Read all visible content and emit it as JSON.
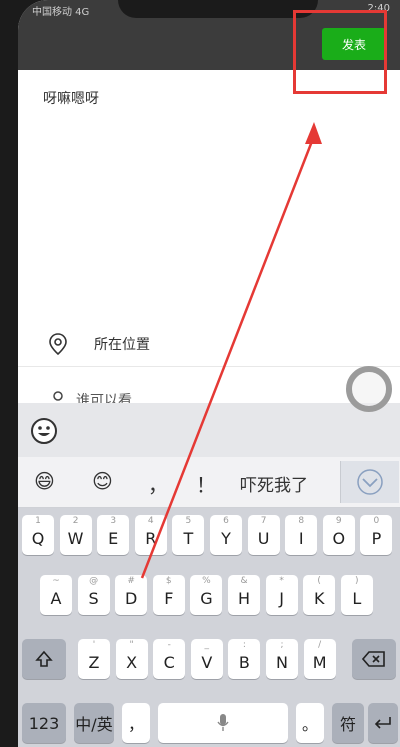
{
  "status": {
    "left": "中国移动 4G",
    "time": "2:40"
  },
  "header": {
    "publish_label": "发表"
  },
  "post": {
    "text": "呀嘛嗯呀"
  },
  "options": {
    "location_label": "所在位置",
    "who_label": "谁可以看"
  },
  "keyboard": {
    "candidates": [
      "😄",
      "😊",
      "，",
      "！",
      "吓死我了"
    ],
    "row1": [
      {
        "k": "Q",
        "h": "1"
      },
      {
        "k": "W",
        "h": "2"
      },
      {
        "k": "E",
        "h": "3"
      },
      {
        "k": "R",
        "h": "4"
      },
      {
        "k": "T",
        "h": "5"
      },
      {
        "k": "Y",
        "h": "6"
      },
      {
        "k": "U",
        "h": "7"
      },
      {
        "k": "I",
        "h": "8"
      },
      {
        "k": "O",
        "h": "9"
      },
      {
        "k": "P",
        "h": "0"
      }
    ],
    "row2": [
      {
        "k": "A",
        "h": "~"
      },
      {
        "k": "S",
        "h": "@"
      },
      {
        "k": "D",
        "h": "#"
      },
      {
        "k": "F",
        "h": "$"
      },
      {
        "k": "G",
        "h": "%"
      },
      {
        "k": "H",
        "h": "&"
      },
      {
        "k": "J",
        "h": "*"
      },
      {
        "k": "K",
        "h": "("
      },
      {
        "k": "L",
        "h": ")"
      }
    ],
    "row3": [
      {
        "k": "Z",
        "h": "'"
      },
      {
        "k": "X",
        "h": "\""
      },
      {
        "k": "C",
        "h": "-"
      },
      {
        "k": "V",
        "h": "_"
      },
      {
        "k": "B",
        "h": ":"
      },
      {
        "k": "N",
        "h": ";"
      },
      {
        "k": "M",
        "h": "/"
      }
    ],
    "numkey": "123",
    "langkey": "中/英",
    "comma": "，",
    "period": "。",
    "symkey": "符"
  },
  "colors": {
    "accent": "#1aad19",
    "annotation": "#e53935"
  }
}
